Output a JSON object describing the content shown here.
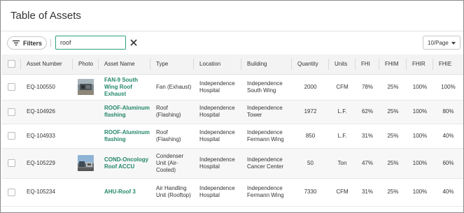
{
  "title": "Table of Assets",
  "toolbar": {
    "filters_label": "Filters",
    "search_value": "roof",
    "per_page": "10/Page"
  },
  "table": {
    "headers": [
      "Asset Number",
      "Photo",
      "Asset Name",
      "Type",
      "Location",
      "Building",
      "Quantity",
      "Units",
      "FHI",
      "FHIM",
      "FHIR",
      "FHIE"
    ],
    "rows": [
      {
        "asset_number": "EQ-100550",
        "has_photo": true,
        "asset_name": "FAN-9 South Wing Roof Exhaust",
        "type": "Fan (Exhaust)",
        "location": "Independence Hospital",
        "building": "Independence South Wing",
        "quantity": "2000",
        "units": "CFM",
        "fhi": "78%",
        "fhim": "25%",
        "fhir": "100%",
        "fhie": "100%"
      },
      {
        "asset_number": "EQ-104926",
        "has_photo": false,
        "asset_name": "ROOF-Aluminum flashing",
        "type": "Roof (Flashing)",
        "location": "Independence Hospital",
        "building": "Independence Tower",
        "quantity": "1972",
        "units": "L.F.",
        "fhi": "62%",
        "fhim": "25%",
        "fhir": "100%",
        "fhie": "80%"
      },
      {
        "asset_number": "EQ-104933",
        "has_photo": false,
        "asset_name": "ROOF-Aluminum flashing",
        "type": "Roof (Flashing)",
        "location": "Independence Hospital",
        "building": "Independence Fermann Wing",
        "quantity": "850",
        "units": "L.F.",
        "fhi": "31%",
        "fhim": "25%",
        "fhir": "100%",
        "fhie": "40%"
      },
      {
        "asset_number": "EQ-105229",
        "has_photo": true,
        "asset_name": "COND-Oncology Roof ACCU",
        "type": "Condenser Unit (Air-Cooled)",
        "location": "Independence Hospital",
        "building": "Independence Cancer Center",
        "quantity": "50",
        "units": "Ton",
        "fhi": "47%",
        "fhim": "25%",
        "fhir": "100%",
        "fhie": "60%"
      },
      {
        "asset_number": "EQ-105234",
        "has_photo": false,
        "asset_name": "AHU-Roof 3",
        "type": "Air Handling Unit (Rooftop)",
        "location": "Independence Hospital",
        "building": "Independence Fermann Wing",
        "quantity": "7330",
        "units": "CFM",
        "fhi": "31%",
        "fhim": "25%",
        "fhir": "100%",
        "fhie": "40%"
      }
    ]
  },
  "colors": {
    "accent": "#23876a",
    "header_bg": "#f3f3f3",
    "stripe_bg": "#f7f7f7"
  },
  "icons": [
    "filter-icon",
    "clear-icon",
    "chevron-down-icon",
    "checkbox-icon"
  ]
}
